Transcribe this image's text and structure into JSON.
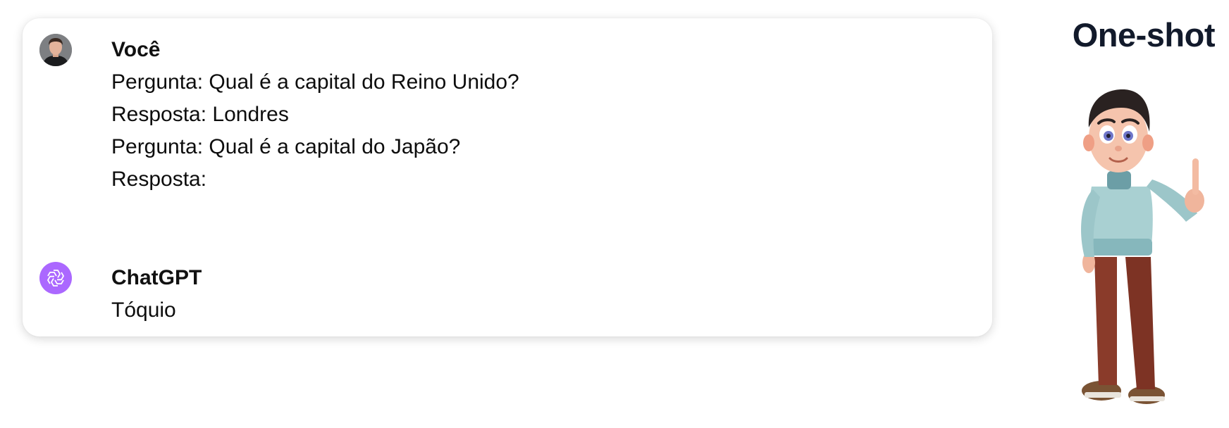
{
  "title": "One-shot",
  "chat": {
    "user": {
      "author": "Você",
      "avatar_icon": "user-photo-avatar",
      "lines": [
        "Pergunta: Qual é a capital do Reino Unido?",
        "Resposta: Londres",
        "Pergunta: Qual é a capital do Japão?",
        "Resposta:"
      ]
    },
    "assistant": {
      "author": "ChatGPT",
      "avatar_icon": "openai-logo-icon",
      "avatar_color": "#ab68ff",
      "reply": "Tóquio"
    }
  },
  "illustration": {
    "icon": "cartoon-man-pointing-up",
    "colors": {
      "sweater": "#a9d0d2",
      "pants": "#8a3b2a",
      "hair": "#2a2221",
      "shoes": "#7a5334"
    }
  }
}
